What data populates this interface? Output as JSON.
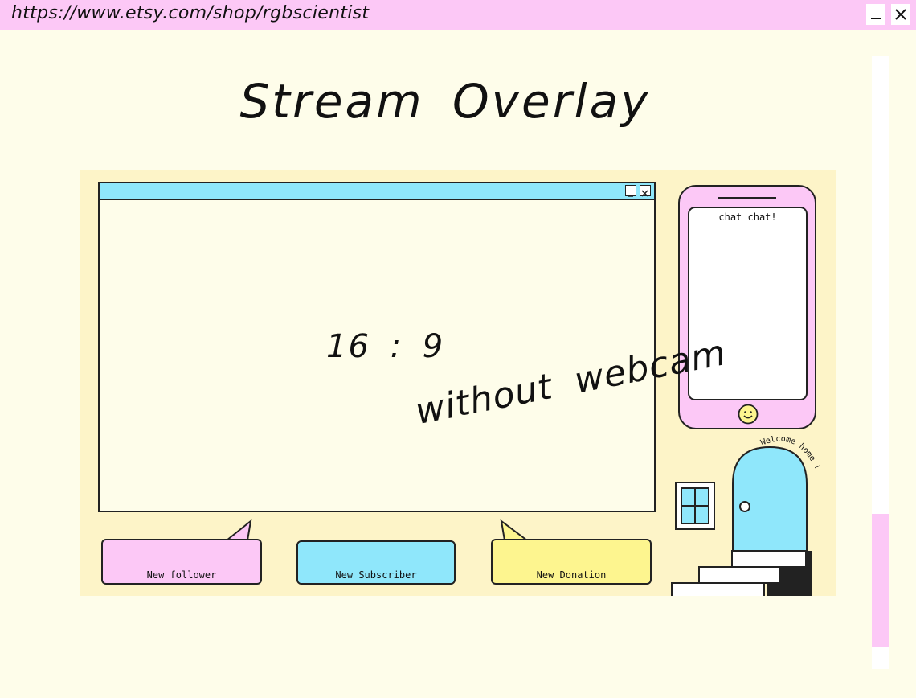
{
  "browser": {
    "url": "https://www.etsy.com/shop/rgbscientist",
    "minimize_icon": "minimize-icon",
    "close_icon": "close-icon"
  },
  "title": "Stream Overlay",
  "overlay": {
    "ratio_text": "16 : 9",
    "caption": "without webcam",
    "chat_label": "chat chat!",
    "alerts": {
      "follower": "New follower",
      "subscriber": "New Subscriber",
      "donation": "New Donation"
    },
    "welcome_text": "Welcome home !"
  },
  "colors": {
    "pink": "#fcc8f6",
    "blue": "#8fe7fb",
    "yellow": "#fdf58f",
    "cream": "#fefdea",
    "panel": "#fdf4c8"
  }
}
